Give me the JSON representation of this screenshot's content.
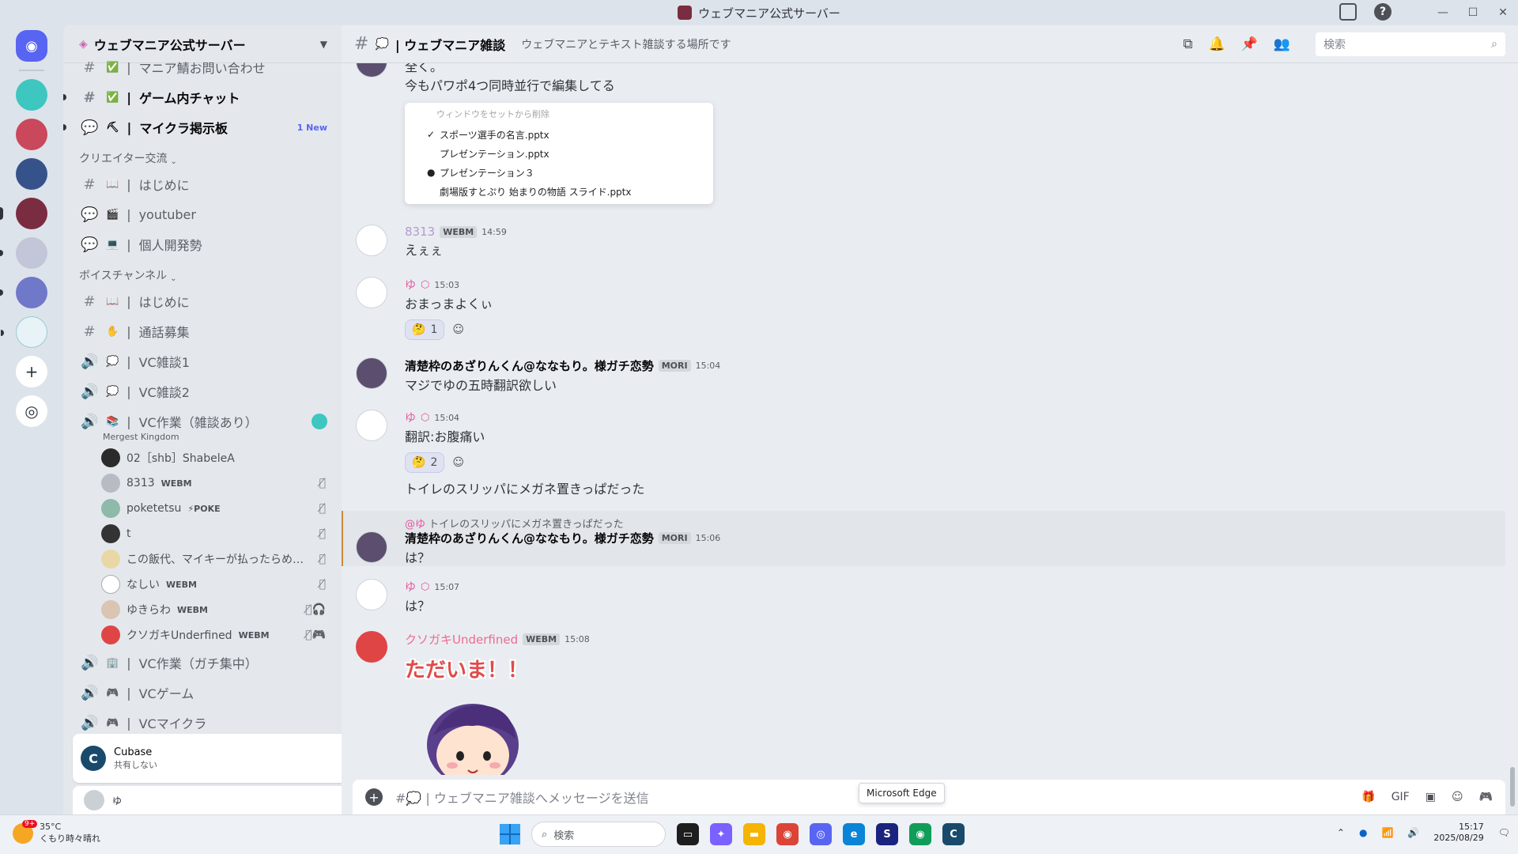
{
  "window": {
    "title": "ウェブマニア公式サーバー",
    "controls": [
      "—",
      "☐",
      "✕"
    ]
  },
  "sidebar": {
    "server_name": "ウェブマニア公式サーバー",
    "channels_top": [
      {
        "icon": "#",
        "emoji": "✅",
        "label": "マニア鯖お問い合わせ",
        "bold": false
      },
      {
        "icon": "#",
        "emoji": "✅",
        "label": "ゲーム内チャット",
        "bold": true
      },
      {
        "icon": "💬",
        "emoji": "⛏",
        "label": "マイクラ掲示板",
        "bold": true,
        "badge": "1 New"
      }
    ],
    "category_creators": "クリエイター交流",
    "channels_creators": [
      {
        "icon": "#",
        "emoji": "📖",
        "label": "はじめに"
      },
      {
        "icon": "💬",
        "emoji": "🎬",
        "label": "youtuber"
      },
      {
        "icon": "💬",
        "emoji": "💻",
        "label": "個人開発勢"
      }
    ],
    "category_voice": "ボイスチャンネル",
    "channels_voice": [
      {
        "icon": "#",
        "emoji": "📖",
        "label": "はじめに"
      },
      {
        "icon": "#",
        "emoji": "✋",
        "label": "通話募集"
      },
      {
        "icon": "🔊",
        "emoji": "💭",
        "label": "VC雑談1"
      },
      {
        "icon": "🔊",
        "emoji": "💭",
        "label": "VC雑談2"
      },
      {
        "icon": "🔊",
        "emoji": "📚",
        "label": "VC作業（雑談あり）"
      }
    ],
    "vc_subtitle": "Mergest Kingdom",
    "vc_users": [
      {
        "name": "02［shb］ShabeleA",
        "tag": "",
        "status": ""
      },
      {
        "name": "8313",
        "tag": "WEBM",
        "status": "mic-off"
      },
      {
        "name": "poketetsu",
        "tag": "⚡POKE",
        "status": "mic-off"
      },
      {
        "name": "t",
        "tag": "",
        "status": "mic-off"
      },
      {
        "name": "この飯代、マイキーが払ったらめ…",
        "tag": "",
        "status": "mic-off"
      },
      {
        "name": "なしい",
        "tag": "WEBM",
        "status": "mic-off"
      },
      {
        "name": "ゆきらわ",
        "tag": "WEBM",
        "status": "mic-off deaf"
      },
      {
        "name": "クソガキUnderfined",
        "tag": "WEBM",
        "status": "mic-off game"
      }
    ],
    "channels_after": [
      {
        "icon": "🔊",
        "emoji": "🏢",
        "label": "VC作業（ガチ集中）"
      },
      {
        "icon": "🔊",
        "emoji": "🎮",
        "label": "VCゲーム"
      },
      {
        "icon": "🔊",
        "emoji": "🎮",
        "label": "VCマイクラ"
      }
    ],
    "activity": {
      "app": "Cubase",
      "status": "共有しない"
    },
    "user_panel_name": "ゆ"
  },
  "chat": {
    "channel_name": "| ウェブマニア雑談",
    "topic": "ウェブマニアとテキスト雑談する場所です",
    "search_placeholder": "検索",
    "composer_placeholder": "#💭 | ウェブマニア雑談へメッセージを送信",
    "tooltip": "Microsoft Edge",
    "first_msg": {
      "line1": "全く。",
      "line2": "今もパワポ4つ同時並行で編集してる",
      "menu_faded": "ウィンドウをセットから削除",
      "menu_items": [
        {
          "mark": "✓",
          "label": "スポーツ選手の名言.pptx"
        },
        {
          "mark": "",
          "label": "プレゼンテーション.pptx"
        },
        {
          "mark": "●",
          "label": "プレゼンテーション３"
        },
        {
          "mark": "",
          "label": "劇場版すとぷり 始まりの物語 スライド.pptx"
        }
      ]
    },
    "messages": [
      {
        "author": "8313",
        "tag": "WEBM",
        "time": "14:59",
        "text": "えぇぇ"
      },
      {
        "author": "ゆ",
        "tag": "",
        "time": "15:03",
        "text": "おまっまよくぃ",
        "reaction": "🤔",
        "count": "1"
      },
      {
        "author": "清楚枠のあざりんくん@ななもり。様ガチ恋勢",
        "tag": "MORI",
        "time": "15:04",
        "text": "マジでゆの五時翻訳欲しい"
      },
      {
        "author": "ゆ",
        "tag": "",
        "time": "15:04",
        "text": "翻訳:お腹痛い",
        "reaction": "🤔",
        "count": "2",
        "extra": "トイレのスリッパにメガネ置きっぱだった"
      },
      {
        "author": "清楚枠のあざりんくん@ななもり。様ガチ恋勢",
        "tag": "MORI",
        "time": "15:06",
        "text": "は？",
        "reply_to": "@ゆ",
        "reply_text": "トイレのスリッパにメガネ置きっぱだった"
      },
      {
        "author": "ゆ",
        "tag": "",
        "time": "15:07",
        "text": "は？"
      },
      {
        "author": "クソガキUnderfined",
        "tag": "WEBM",
        "time": "15:08",
        "sticker_text": "ただいま！！"
      }
    ]
  },
  "taskbar": {
    "weather_temp": "35°C",
    "weather_desc": "くもり時々晴れ",
    "weather_badge": "9+",
    "search": "検索",
    "time": "15:17",
    "date": "2025/08/29"
  },
  "colors": {
    "accent": "#5865f2",
    "highlight_bar": "#c98a3a",
    "pink_name": "#e3559c"
  }
}
